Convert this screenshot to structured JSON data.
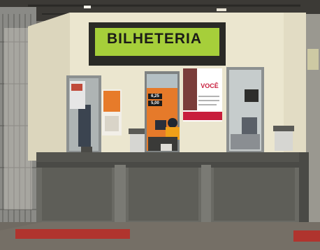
{
  "sign": {
    "title": "BILHETERIA",
    "color": "#a6cf3a"
  },
  "window_center": {
    "price_top": "6,25",
    "price_bottom": "5,00"
  },
  "poster_right": {
    "headline": "VOCÊ"
  },
  "colors": {
    "wall": "#ebe6cf",
    "counter": "#5c5c58",
    "floor": "#6f6a62",
    "tactile_strip": "#b0342e"
  }
}
